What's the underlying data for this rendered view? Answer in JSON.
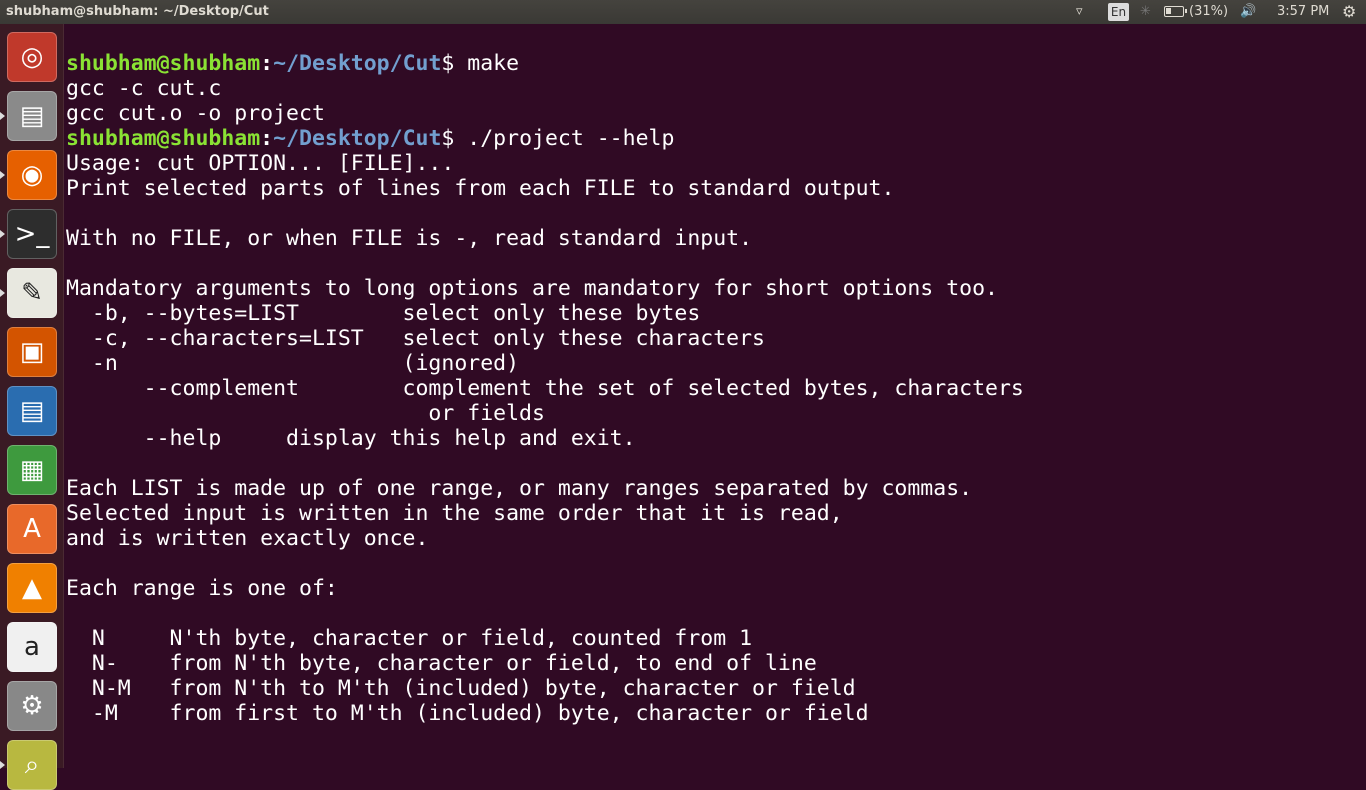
{
  "window": {
    "title": "shubham@shubham: ~/Desktop/Cut"
  },
  "indicators": {
    "keyboard": "En",
    "battery": "(31%)",
    "clock": "3:57 PM",
    "battery_level_percent": 31
  },
  "launcher": [
    {
      "name": "ubuntu-dash",
      "color": "#c0392b"
    },
    {
      "name": "files",
      "color": "#8a8a8a"
    },
    {
      "name": "firefox",
      "color": "#e66000"
    },
    {
      "name": "terminal",
      "color": "#2d2d2d"
    },
    {
      "name": "text-editor",
      "color": "#e8e8e0"
    },
    {
      "name": "libreoffice-impress",
      "color": "#d35400"
    },
    {
      "name": "libreoffice-writer",
      "color": "#2a6db0"
    },
    {
      "name": "libreoffice-calc",
      "color": "#3e9a3e"
    },
    {
      "name": "software-center",
      "color": "#e8692a"
    },
    {
      "name": "vlc",
      "color": "#f08000"
    },
    {
      "name": "amazon",
      "color": "#f0f0f0"
    },
    {
      "name": "system-settings",
      "color": "#888888"
    },
    {
      "name": "image-viewer",
      "color": "#b8b840"
    }
  ],
  "terminal": {
    "prompt_user": "shubham@shubham",
    "prompt_path": "~/Desktop/Cut",
    "commands": [
      "make",
      "./project --help"
    ],
    "output1": [
      "gcc -c cut.c",
      "gcc cut.o -o project"
    ],
    "output2": [
      "Usage: cut OPTION... [FILE]...",
      "Print selected parts of lines from each FILE to standard output.",
      "",
      "With no FILE, or when FILE is -, read standard input.",
      "",
      "Mandatory arguments to long options are mandatory for short options too.",
      "  -b, --bytes=LIST        select only these bytes",
      "  -c, --characters=LIST   select only these characters",
      "  -n                      (ignored)",
      "      --complement        complement the set of selected bytes, characters",
      "                            or fields",
      "      --help     display this help and exit.",
      "",
      "Each LIST is made up of one range, or many ranges separated by commas.",
      "Selected input is written in the same order that it is read,",
      "and is written exactly once.",
      "",
      "Each range is one of:",
      "",
      "  N     N'th byte, character or field, counted from 1",
      "  N-    from N'th byte, character or field, to end of line",
      "  N-M   from N'th to M'th (included) byte, character or field",
      "  -M    from first to M'th (included) byte, character or field"
    ]
  }
}
